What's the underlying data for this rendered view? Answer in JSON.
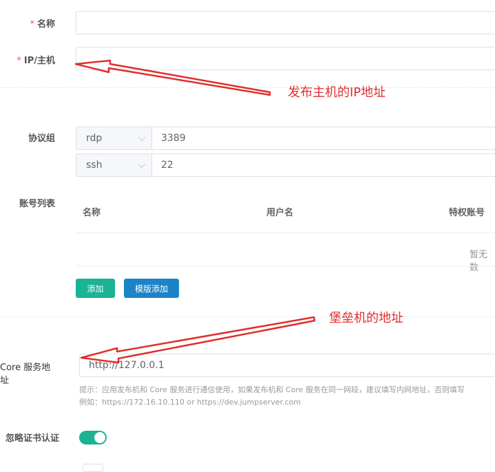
{
  "form": {
    "name_label": "名称",
    "name_required": "*",
    "name_value": "",
    "host_label": "IP/主机",
    "host_required": "*",
    "host_value": "",
    "protocols_label": "协议组",
    "protocols": [
      {
        "name": "rdp",
        "port": "3389"
      },
      {
        "name": "ssh",
        "port": "22"
      }
    ],
    "accounts_label": "账号列表",
    "accounts_table": {
      "columns": [
        "名称",
        "用户名",
        "特权账号"
      ],
      "empty_text": "暂无数"
    },
    "add_button": "添加",
    "template_add_button": "模版添加",
    "core_label": "Core 服务地址",
    "core_value": "http://127.0.0.1",
    "core_hint_line1": "提示：应用发布机和 Core 服务进行通信使用，如果发布机和 Core 服务在同一网段，建议填写内网地址，否则填写",
    "core_hint_line2": "例如：https://172.16.10.110 or https://dev.jumpserver.com",
    "ignore_cert_label": "忽略证书认证",
    "ignore_cert_enabled": true
  },
  "annotations": {
    "host_note": "发布主机的IP地址",
    "core_note": "堡垒机的地址"
  },
  "colors": {
    "primary": "#1ab394",
    "info": "#1c84c6",
    "annotation": "#e02d2d",
    "required": "#ed5565"
  }
}
